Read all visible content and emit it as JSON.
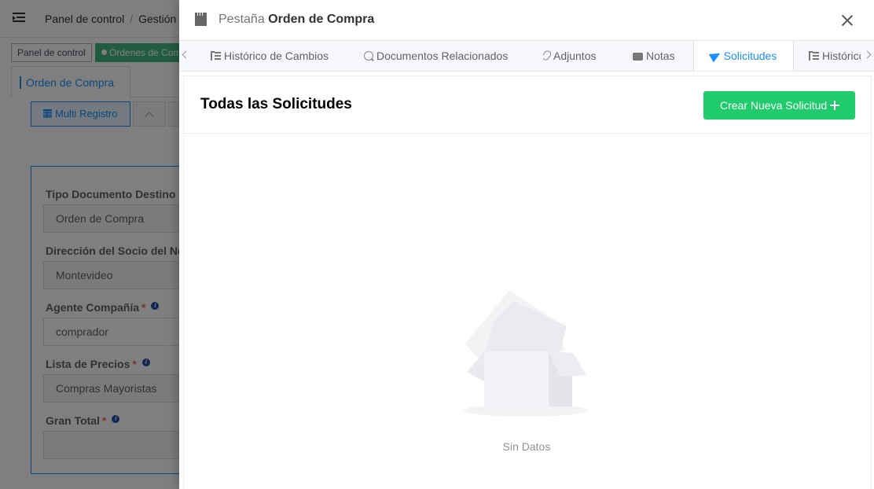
{
  "background": {
    "breadcrumb": {
      "home": "Panel de control",
      "separator": "/",
      "current": "Gestión"
    },
    "tags": {
      "home": "Panel de control",
      "active": "Órdenes de Compra"
    },
    "tab": "Orden de Compra",
    "multi_record_button": "Multi Registro",
    "fields": [
      {
        "label": "Tipo Documento Destino",
        "value": "Orden de Compra",
        "required": false,
        "info": false
      },
      {
        "label": "Dirección del Socio del Negocio",
        "value": "Montevideo",
        "required": false,
        "info": false
      },
      {
        "label": "Agente Compañía",
        "value": "comprador",
        "required": true,
        "info": true
      },
      {
        "label": "Lista de Precios",
        "value": "Compras Mayoristas",
        "required": true,
        "info": true
      },
      {
        "label": "Gran Total",
        "value": "",
        "required": true,
        "info": true
      }
    ],
    "required_mark": "*",
    "info_mark": "i"
  },
  "drawer": {
    "title_prefix": "Pestaña",
    "title_name": "Orden de Compra",
    "tabs": [
      {
        "label": "Histórico de Cambios",
        "icon": "list-icon",
        "active": false
      },
      {
        "label": "Documentos Relacionados",
        "icon": "zoom-in-icon",
        "active": false
      },
      {
        "label": "Adjuntos",
        "icon": "paperclip-icon",
        "active": false
      },
      {
        "label": "Notas",
        "icon": "comment-icon",
        "active": false
      },
      {
        "label": "Solicitudes",
        "icon": "send-icon",
        "active": true
      },
      {
        "label": "Histórico",
        "icon": "list-icon",
        "active": false
      }
    ],
    "content": {
      "title": "Todas las Solicitudes",
      "new_button": "Crear Nueva Solicitud",
      "empty_text": "Sin Datos"
    }
  },
  "colors": {
    "accent": "#1890ff",
    "success_button": "#1fcb6a",
    "active_tag": "#42b983",
    "required": "#f56c6c"
  }
}
